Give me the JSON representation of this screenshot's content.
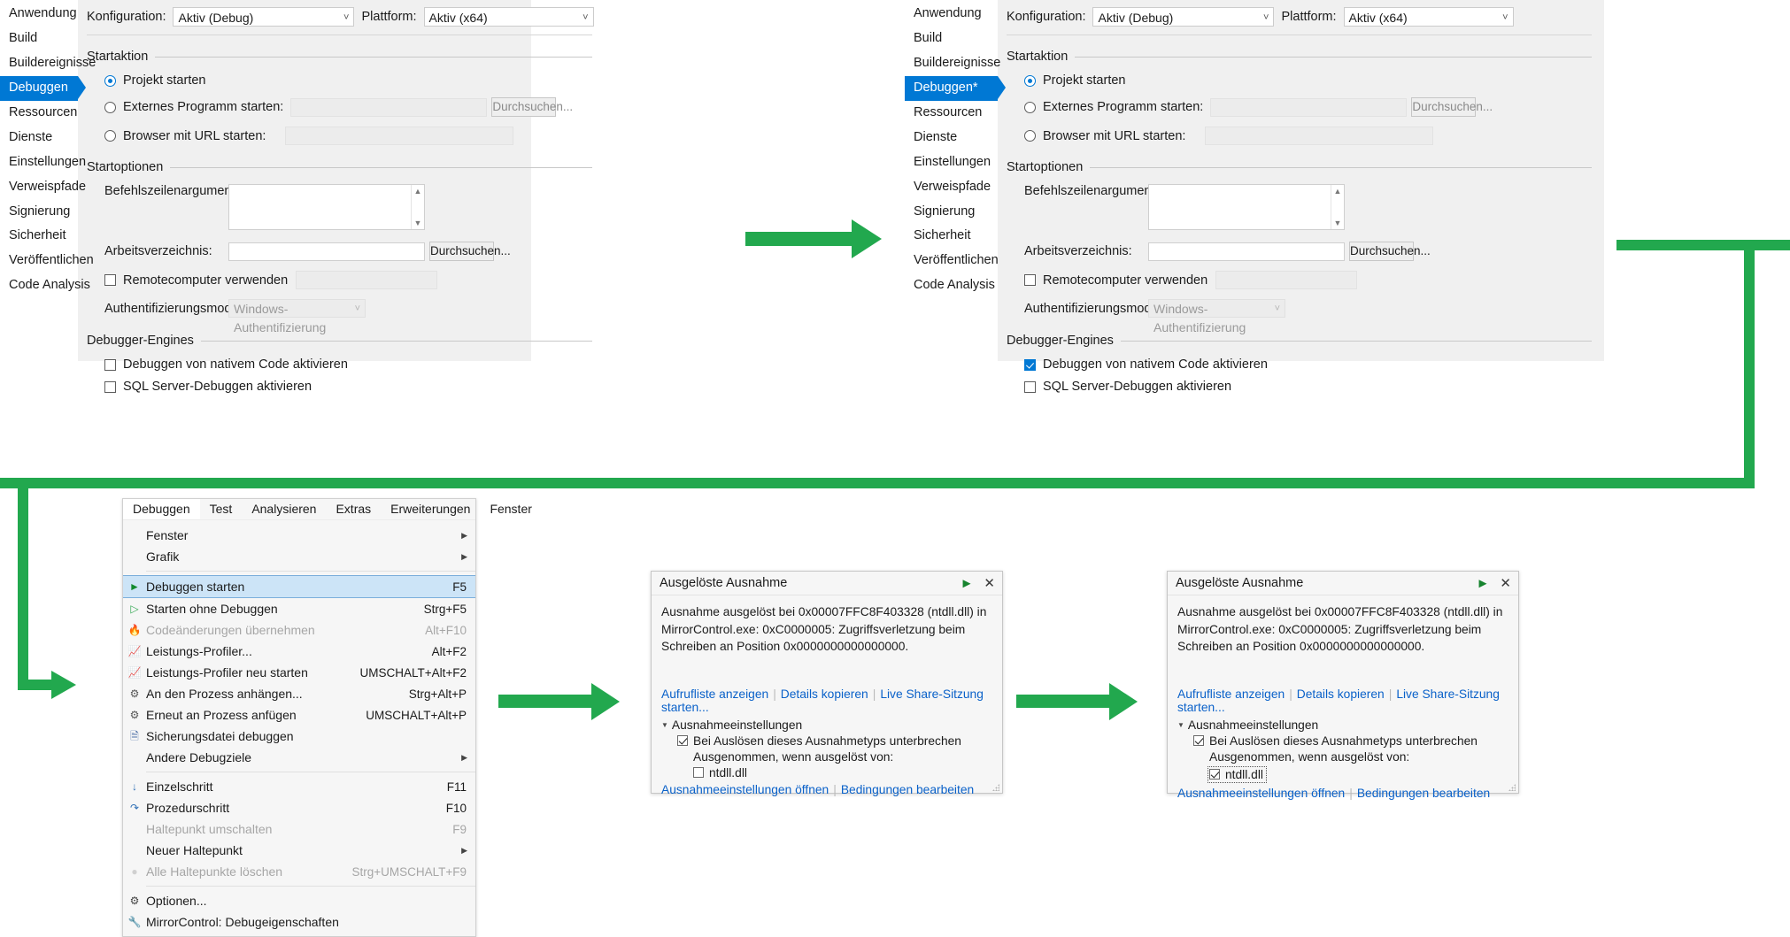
{
  "meta": {
    "accent_blue": "#0078d4",
    "arrow_green": "#22a84e",
    "link_blue": "#0a61c9"
  },
  "property_pages": {
    "sidebar_items": [
      "Anwendung",
      "Build",
      "Buildereignisse",
      "Debuggen",
      "Ressourcen",
      "Dienste",
      "Einstellungen",
      "Verweispfade",
      "Signierung",
      "Sicherheit",
      "Veröffentlichen",
      "Code Analysis"
    ],
    "sidebar_items_modified": [
      "Anwendung",
      "Build",
      "Buildereignisse",
      "Debuggen*",
      "Ressourcen",
      "Dienste",
      "Einstellungen",
      "Verweispfade",
      "Signierung",
      "Sicherheit",
      "Veröffentlichen",
      "Code Analysis"
    ],
    "selected_index": 3,
    "config_label": "Konfiguration:",
    "config_value": "Aktiv (Debug)",
    "platform_label": "Plattform:",
    "platform_value": "Aktiv (x64)",
    "group_startaktion": "Startaktion",
    "radio_projekt": "Projekt starten",
    "radio_externes": "Externes Programm starten:",
    "radio_browser": "Browser mit URL starten:",
    "browse_button": "Durchsuchen...",
    "group_startoptionen": "Startoptionen",
    "label_args": "Befehlszeilenargumente:",
    "label_workdir": "Arbeitsverzeichnis:",
    "check_remote": "Remotecomputer verwenden",
    "label_auth": "Authentifizierungsmodus:",
    "auth_value": "Windows-Authentifizierung",
    "group_engines": "Debugger-Engines",
    "check_native": "Debuggen von nativem Code aktivieren",
    "check_sql": "SQL Server-Debuggen aktivieren",
    "native_checked_before": false,
    "native_checked_after": true,
    "sql_checked": false
  },
  "menu": {
    "menubar": [
      "Debuggen",
      "Test",
      "Analysieren",
      "Extras",
      "Erweiterungen",
      "Fenster"
    ],
    "active_menubar_index": 0,
    "items": [
      {
        "icon": "",
        "label": "Fenster",
        "key": "",
        "submenu": true,
        "disabled": false,
        "selected": false,
        "sep_before": false
      },
      {
        "icon": "",
        "label": "Grafik",
        "key": "",
        "submenu": true,
        "disabled": false,
        "selected": false,
        "sep_before": false
      },
      {
        "icon": "play-filled-icon",
        "label": "Debuggen starten",
        "key": "F5",
        "submenu": false,
        "disabled": false,
        "selected": true,
        "sep_before": true
      },
      {
        "icon": "play-outline-icon",
        "label": "Starten ohne Debuggen",
        "key": "Strg+F5",
        "submenu": false,
        "disabled": false,
        "selected": false,
        "sep_before": false
      },
      {
        "icon": "hot-reload-icon",
        "label": "Codeänderungen übernehmen",
        "key": "Alt+F10",
        "submenu": false,
        "disabled": true,
        "selected": false,
        "sep_before": false
      },
      {
        "icon": "profiler-icon",
        "label": "Leistungs-Profiler...",
        "key": "Alt+F2",
        "submenu": false,
        "disabled": false,
        "selected": false,
        "sep_before": false
      },
      {
        "icon": "profiler-restart-icon",
        "label": "Leistungs-Profiler neu starten",
        "key": "UMSCHALT+Alt+F2",
        "submenu": false,
        "disabled": false,
        "selected": false,
        "sep_before": false
      },
      {
        "icon": "attach-process-icon",
        "label": "An den Prozess anhängen...",
        "key": "Strg+Alt+P",
        "submenu": false,
        "disabled": false,
        "selected": false,
        "sep_before": false
      },
      {
        "icon": "reattach-process-icon",
        "label": "Erneut an Prozess anfügen",
        "key": "UMSCHALT+Alt+P",
        "submenu": false,
        "disabled": false,
        "selected": false,
        "sep_before": false
      },
      {
        "icon": "dump-file-icon",
        "label": "Sicherungsdatei debuggen",
        "key": "",
        "submenu": false,
        "disabled": false,
        "selected": false,
        "sep_before": false
      },
      {
        "icon": "",
        "label": "Andere Debugziele",
        "key": "",
        "submenu": true,
        "disabled": false,
        "selected": false,
        "sep_before": false
      },
      {
        "icon": "step-into-icon",
        "label": "Einzelschritt",
        "key": "F11",
        "submenu": false,
        "disabled": false,
        "selected": false,
        "sep_before": true
      },
      {
        "icon": "step-over-icon",
        "label": "Prozedurschritt",
        "key": "F10",
        "submenu": false,
        "disabled": false,
        "selected": false,
        "sep_before": false
      },
      {
        "icon": "",
        "label": "Haltepunkt umschalten",
        "key": "F9",
        "submenu": false,
        "disabled": true,
        "selected": false,
        "sep_before": false
      },
      {
        "icon": "",
        "label": "Neuer Haltepunkt",
        "key": "",
        "submenu": true,
        "disabled": false,
        "selected": false,
        "sep_before": false
      },
      {
        "icon": "delete-breakpoints-icon",
        "label": "Alle Haltepunkte löschen",
        "key": "Strg+UMSCHALT+F9",
        "submenu": false,
        "disabled": true,
        "selected": false,
        "sep_before": false
      },
      {
        "icon": "gear-icon",
        "label": "Optionen...",
        "key": "",
        "submenu": false,
        "disabled": false,
        "selected": false,
        "sep_before": true
      },
      {
        "icon": "wrench-icon",
        "label": "MirrorControl: Debugeigenschaften",
        "key": "",
        "submenu": false,
        "disabled": false,
        "selected": false,
        "sep_before": false
      }
    ]
  },
  "exception_dialog": {
    "title": "Ausgelöste Ausnahme",
    "message": "Ausnahme ausgelöst bei 0x00007FFC8F403328 (ntdll.dll) in MirrorControl.exe: 0xC0000005: Zugriffsverletzung beim Schreiben an Position 0x0000000000000000.",
    "links": [
      "Aufrufliste anzeigen",
      "Details kopieren",
      "Live Share-Sitzung starten..."
    ],
    "settings_group": "Ausnahmeeinstellungen",
    "check_break": "Bei Auslösen dieses Ausnahmetyps unterbrechen",
    "except_when": "Ausgenommen, wenn ausgelöst von:",
    "module": "ntdll.dll",
    "footer_links": [
      "Ausnahmeeinstellungen öffnen",
      "Bedingungen bearbeiten"
    ],
    "break_checked": true,
    "module_checked_before": false,
    "module_checked_after": true
  }
}
